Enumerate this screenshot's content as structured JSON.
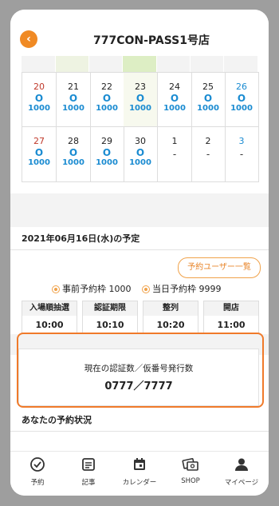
{
  "header": {
    "title": "777CON-PASS1号店",
    "back_icon": "chevron-left-icon",
    "accent": "#f08a24"
  },
  "calendar": {
    "rows": [
      [
        {
          "day": "20",
          "mark": "O",
          "cap": "1000",
          "color": "#c0392b"
        },
        {
          "day": "21",
          "mark": "O",
          "cap": "1000"
        },
        {
          "day": "22",
          "mark": "O",
          "cap": "1000"
        },
        {
          "day": "23",
          "mark": "O",
          "cap": "1000",
          "today": true
        },
        {
          "day": "24",
          "mark": "O",
          "cap": "1000"
        },
        {
          "day": "25",
          "mark": "O",
          "cap": "1000"
        },
        {
          "day": "26",
          "mark": "O",
          "cap": "1000",
          "color": "#1a8bd1"
        }
      ],
      [
        {
          "day": "27",
          "mark": "O",
          "cap": "1000",
          "color": "#c0392b"
        },
        {
          "day": "28",
          "mark": "O",
          "cap": "1000"
        },
        {
          "day": "29",
          "mark": "O",
          "cap": "1000"
        },
        {
          "day": "30",
          "mark": "O",
          "cap": "1000"
        },
        {
          "day": "1",
          "dash": "-"
        },
        {
          "day": "2",
          "dash": "-"
        },
        {
          "day": "3",
          "dash": "-",
          "color": "#1a8bd1"
        }
      ]
    ]
  },
  "schedule": {
    "date_title": "2021年06月16日(水)の予定",
    "list_button": "予約ユーザー一覧",
    "advance_label": "事前予約枠",
    "advance_value": "1000",
    "sameday_label": "当日予約枠",
    "sameday_value": "9999",
    "boxes": [
      {
        "label": "入場順抽選",
        "value": "10:00"
      },
      {
        "label": "認証期限",
        "value": "10:10"
      },
      {
        "label": "整列",
        "value": "10:20"
      },
      {
        "label": "開店",
        "value": "11:00"
      }
    ],
    "auth_caption": "現在の認証数／仮番号発行数",
    "auth_value": "0777／7777",
    "reservation_status": "あなたの予約状況"
  },
  "nav": [
    {
      "label": "予約",
      "icon": "check-circle-icon"
    },
    {
      "label": "記事",
      "icon": "article-icon"
    },
    {
      "label": "カレンダー",
      "icon": "calendar-icon"
    },
    {
      "label": "SHOP",
      "icon": "shop-icon"
    },
    {
      "label": "マイページ",
      "icon": "user-icon"
    }
  ],
  "colors": {
    "highlight": "#f07a2a",
    "available": "#1a8bd1"
  }
}
